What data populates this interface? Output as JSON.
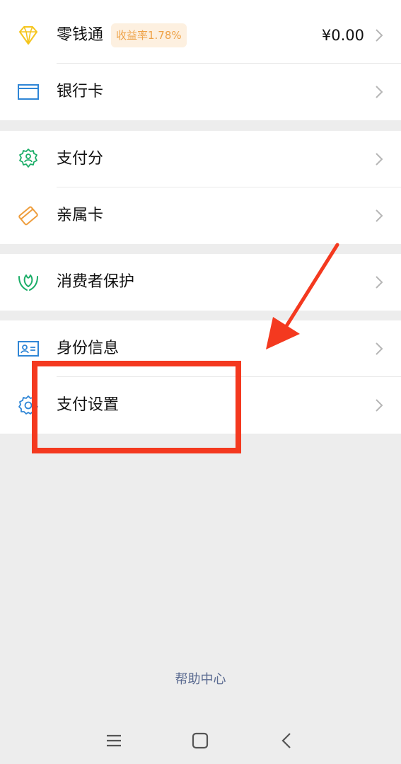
{
  "menu": {
    "wallet": {
      "label": "零钱通",
      "badge": "收益率1.78%",
      "amount": "¥0.00"
    },
    "bank_card": {
      "label": "银行卡"
    },
    "pay_score": {
      "label": "支付分"
    },
    "family_card": {
      "label": "亲属卡"
    },
    "consumer_protection": {
      "label": "消费者保护"
    },
    "identity_info": {
      "label": "身份信息"
    },
    "payment_settings": {
      "label": "支付设置"
    }
  },
  "footer": {
    "help_center": "帮助中心"
  },
  "icons": {
    "wallet": "diamond-icon",
    "bank_card": "card-icon",
    "pay_score": "badge-person-icon",
    "family_card": "family-card-icon",
    "consumer_protection": "hands-leaf-icon",
    "identity_info": "id-card-icon",
    "payment_settings": "gear-icon"
  },
  "colors": {
    "annotation": "#f4391f",
    "badge_text": "#eea247",
    "badge_bg": "#fdf0e0",
    "help_link": "#5b6b91",
    "background": "#ededed"
  }
}
